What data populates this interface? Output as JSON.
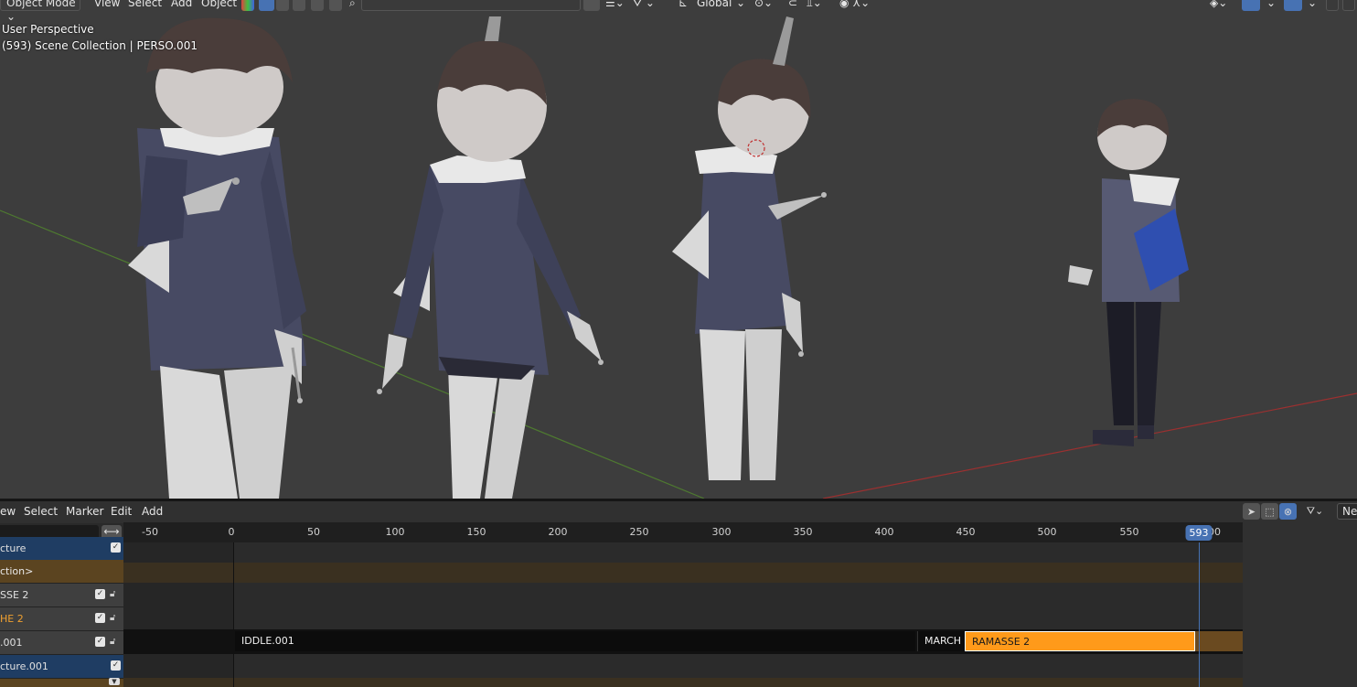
{
  "viewport": {
    "mode_label": "Object Mode",
    "menus": [
      "View",
      "Select",
      "Add",
      "Object"
    ],
    "transform_orientation": "Global",
    "overlay_line1": "User Perspective",
    "overlay_line2": "(593) Scene Collection | PERSO.001"
  },
  "nla": {
    "menus": [
      "ew",
      "Select",
      "Marker",
      "Edit",
      "Add"
    ],
    "snap_label": "Nea",
    "ruler_ticks": [
      "-50",
      "0",
      "50",
      "100",
      "150",
      "200",
      "250",
      "300",
      "350",
      "400",
      "450",
      "500",
      "550",
      "593",
      "00"
    ],
    "current_frame": "593",
    "channels": [
      {
        "label": "cture",
        "style": "blue"
      },
      {
        "label": "ction>",
        "style": "brown"
      },
      {
        "label": "SSE 2",
        "style": "grey"
      },
      {
        "label": "HE 2",
        "style": "grey"
      },
      {
        "label": ".001",
        "style": "grey"
      },
      {
        "label": "cture.001",
        "style": "blue"
      }
    ],
    "strips": [
      "IDDLE.001",
      "MARCH",
      "RAMASSE 2"
    ]
  },
  "colors": {
    "accent_blue": "#4772b3",
    "strip_selected": "#ff9a1a",
    "action_row": "#5b4420",
    "x_axis": "#9b3030",
    "y_axis": "#4e7a30"
  }
}
